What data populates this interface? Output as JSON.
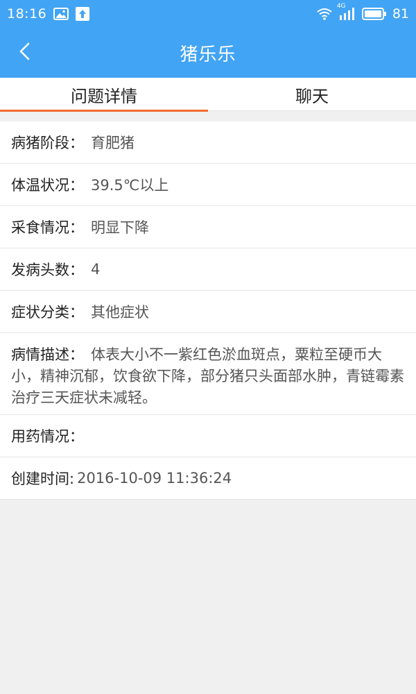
{
  "status_bar": {
    "time": "18:16",
    "network_label": "4G",
    "battery_level": "81",
    "icons": [
      "image-icon",
      "upload-icon",
      "wifi-icon",
      "signal-icon",
      "battery-icon"
    ]
  },
  "app_bar": {
    "title": "猪乐乐",
    "back_icon": "chevron-left-icon"
  },
  "tabs": [
    {
      "label": "问题详情",
      "active": true
    },
    {
      "label": "聊天",
      "active": false
    }
  ],
  "details": {
    "stage": {
      "label": "病猪阶段：",
      "value": "育肥猪"
    },
    "temperature": {
      "label": "体温状况：",
      "value": "39.5℃以上"
    },
    "feeding": {
      "label": "采食情况：",
      "value": "明显下降"
    },
    "count": {
      "label": "发病头数：",
      "value": "4"
    },
    "symptom_type": {
      "label": "症状分类：",
      "value": "其他症状"
    },
    "description": {
      "label": "病情描述：",
      "value": "体表大小不一紫红色淤血斑点，粟粒至硬币大小，精神沉郁，饮食欲下降，部分猪只头面部水肿，青链霉素治疗三天症状未减轻。"
    },
    "medication": {
      "label": "用药情况：",
      "value": ""
    },
    "created": {
      "label": "创建时间:",
      "value": "2016-10-09 11:36:24"
    }
  },
  "colors": {
    "primary": "#42a4f4",
    "tab_indicator": "#f36a2d",
    "background": "#f0f0f0"
  }
}
